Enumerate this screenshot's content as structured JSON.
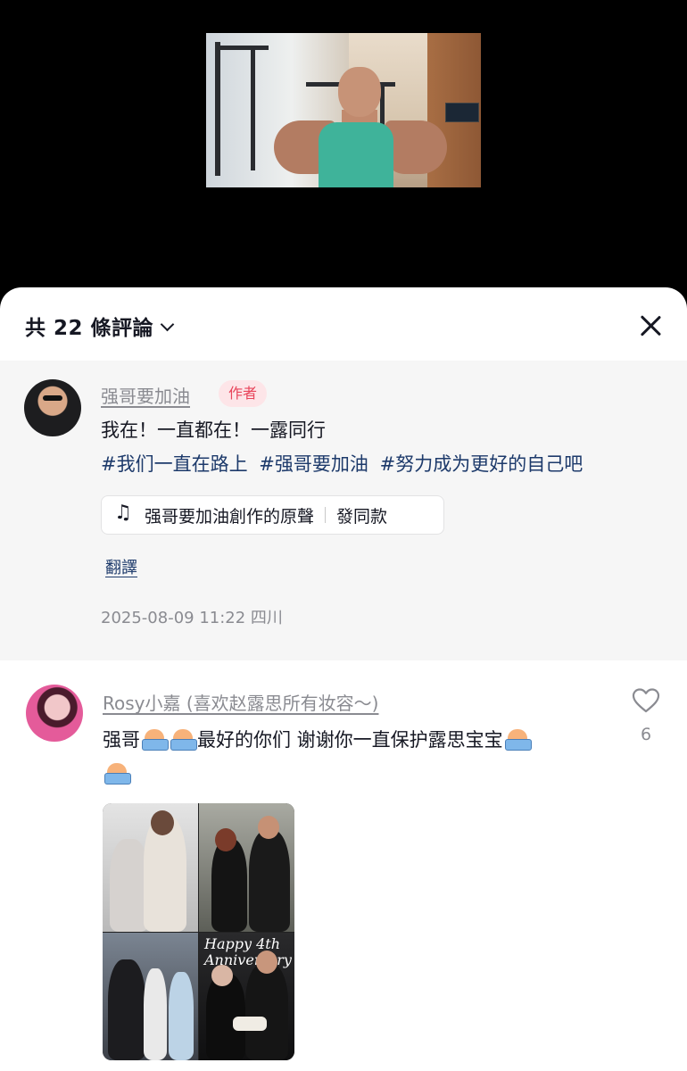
{
  "video": {
    "description_icon": "video-thumbnail"
  },
  "header": {
    "count_title": "共 22 條評論"
  },
  "author_comment": {
    "username": "强哥要加油",
    "badge": "作者",
    "text": "我在！一直都在！一露同行",
    "tags": [
      "#我们一直在路上",
      "#强哥要加油",
      "#努力成为更好的自己吧"
    ],
    "sound": {
      "name": "强哥要加油創作的原聲",
      "action": "發同款"
    },
    "translate": "翻譯",
    "timestamp": "2025-08-09 11:22 四川"
  },
  "user_comment": {
    "username": "Rosy小嘉 (喜欢赵露思所有妆容～)",
    "text_part1": "强哥",
    "text_part2": "最好的你们 谢谢你一直保护露思宝宝",
    "likes": "6",
    "collage_text": [
      "Happy 4th",
      "Anniversary"
    ]
  }
}
